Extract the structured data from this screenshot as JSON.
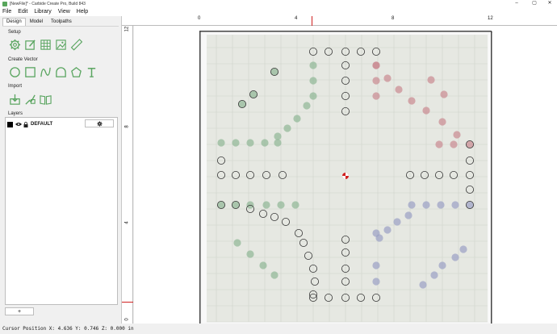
{
  "window": {
    "title": "[NewFile]* - Carbide Create Pro, Build 843",
    "controls": [
      "–",
      "▢",
      "✕"
    ]
  },
  "menus": [
    "File",
    "Edit",
    "Library",
    "View",
    "Help"
  ],
  "tabs": [
    "Design",
    "Model",
    "Toolpaths"
  ],
  "sections": {
    "setup": "Setup",
    "create_vector": "Create Vector",
    "import": "Import",
    "layers": "Layers"
  },
  "setup_tools": [
    "gear-icon",
    "edit-stock-icon",
    "grid-icon",
    "image-icon",
    "ruler-icon"
  ],
  "vector_tools": [
    "circle-icon",
    "rectangle-icon",
    "curve-icon",
    "arch-icon",
    "polygon-icon",
    "text-icon"
  ],
  "import_tools": [
    "import-icon",
    "import-svg-icon",
    "library-book-icon"
  ],
  "layer": {
    "name": "DEFAULT",
    "settings_icon": "gear-icon"
  },
  "add_layer_label": "+",
  "ruler": {
    "h_labels": [
      "0",
      "4",
      "8",
      "12"
    ],
    "v_labels": [
      "12",
      "8",
      "4",
      "0"
    ]
  },
  "status": "Cursor Position X: 4.636 Y: 0.746 Z: 0.000 in",
  "colors": {
    "accent_green": "#5aa560",
    "cursor_marker": "#d02020",
    "hole_red": "#c98a92",
    "hole_green": "#8fb796",
    "hole_blue": "#9aa0c4"
  }
}
